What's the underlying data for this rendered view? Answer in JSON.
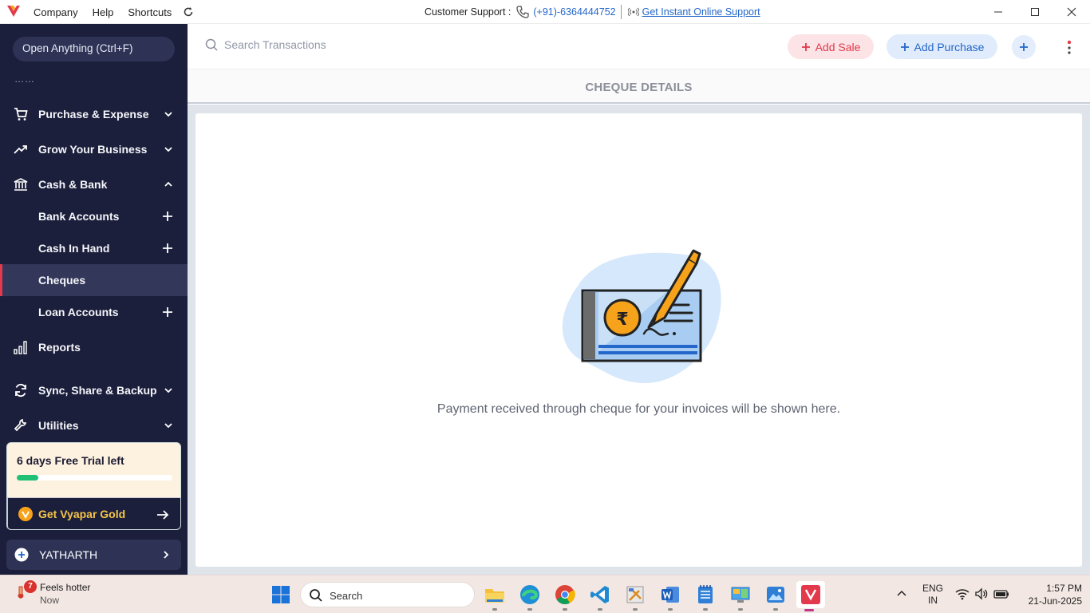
{
  "titlebar": {
    "menu": [
      "Company",
      "Help",
      "Shortcuts"
    ],
    "support_label": "Customer Support :",
    "support_phone": "(+91)-6364444752",
    "support_link": "Get Instant Online Support"
  },
  "sidebar": {
    "open_anything": "Open Anything (Ctrl+F)",
    "dots": "……",
    "items": [
      {
        "label": "Purchase & Expense"
      },
      {
        "label": "Grow Your Business"
      },
      {
        "label": "Cash & Bank"
      },
      {
        "label": "Bank Accounts"
      },
      {
        "label": "Cash In Hand"
      },
      {
        "label": "Cheques"
      },
      {
        "label": "Loan Accounts"
      },
      {
        "label": "Reports"
      },
      {
        "label": "Sync, Share & Backup"
      },
      {
        "label": "Utilities"
      }
    ],
    "trial": {
      "title": "6 days Free Trial left",
      "progress": 0.14
    },
    "gold_label": "Get Vyapar Gold",
    "company_name": "YATHARTH"
  },
  "topbar": {
    "search_placeholder": "Search Transactions",
    "add_sale": "Add Sale",
    "add_purchase": "Add Purchase"
  },
  "page": {
    "title": "CHEQUE DETAILS",
    "empty_message": "Payment received through cheque for your invoices will be shown here."
  },
  "taskbar": {
    "weather_badge": "7",
    "weather_title": "Feels hotter",
    "weather_sub": "Now",
    "search": "Search",
    "lang_top": "ENG",
    "lang_bottom": "IN",
    "time": "1:57 PM",
    "date": "21-Jun-2025"
  },
  "colors": {
    "sidebar_bg": "#1c1f3b",
    "accent_red": "#e23a4c",
    "accent_blue": "#2466c9",
    "gold": "#f6c548"
  }
}
